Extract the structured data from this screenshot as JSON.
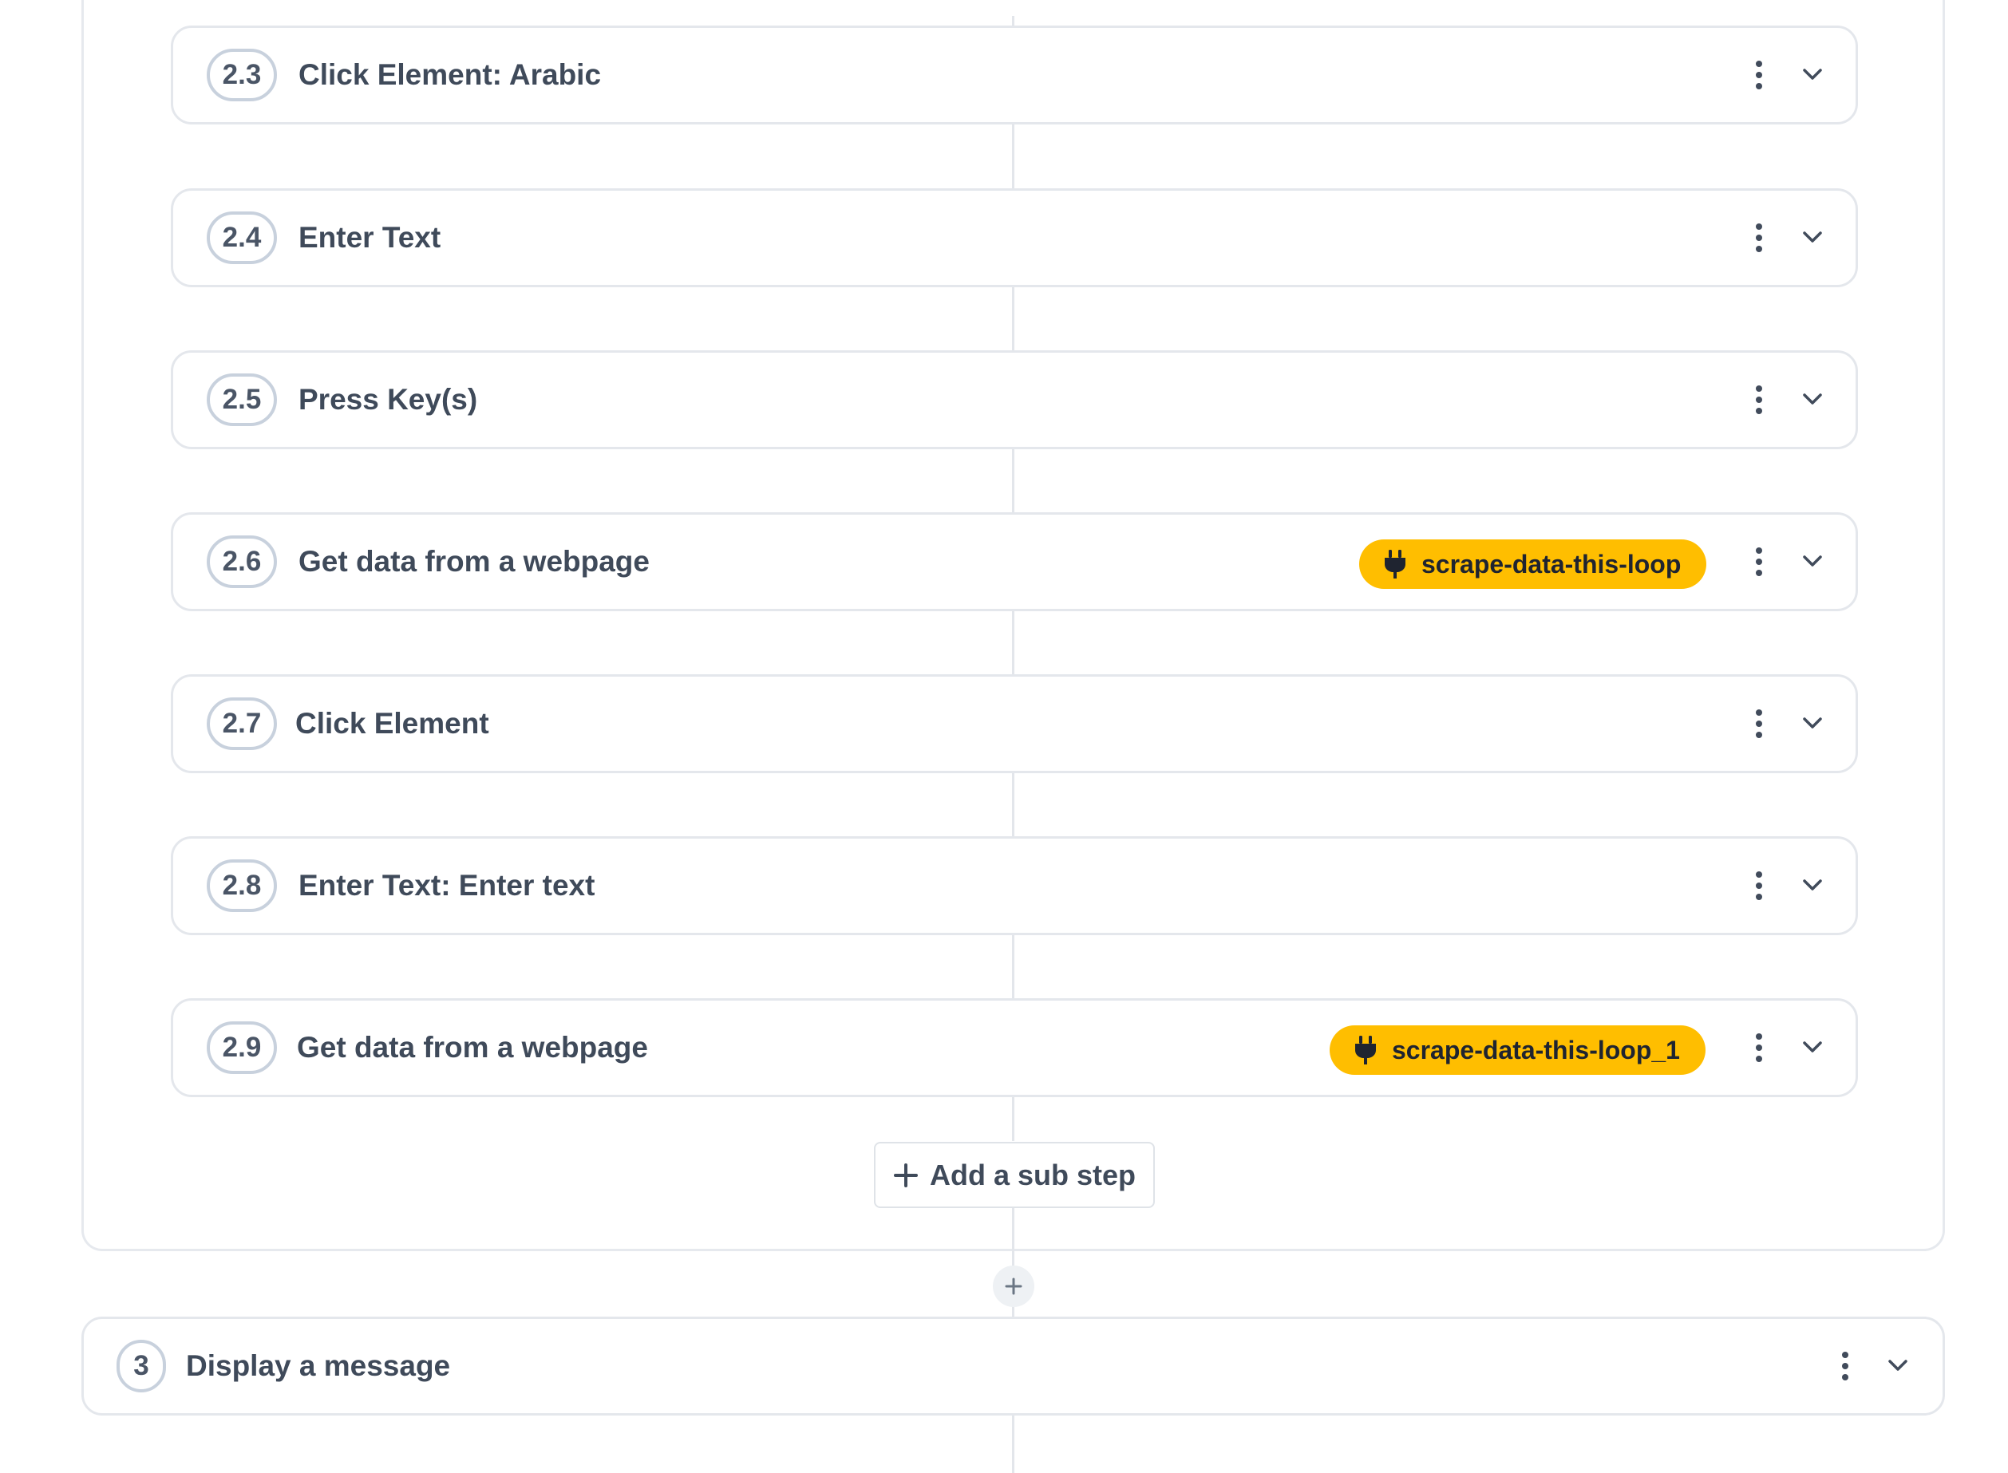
{
  "sub_steps": [
    {
      "number": "2.3",
      "title": "Click Element: Arabic",
      "tag": null
    },
    {
      "number": "2.4",
      "title": "Enter Text",
      "tag": null
    },
    {
      "number": "2.5",
      "title": "Press Key(s)",
      "tag": null
    },
    {
      "number": "2.6",
      "title": "Get data from a webpage",
      "tag": "scrape-data-this-loop"
    },
    {
      "number": "2.7",
      "title": "Click Element",
      "tag": null
    },
    {
      "number": "2.8",
      "title": "Enter Text: Enter text",
      "tag": null
    },
    {
      "number": "2.9",
      "title": "Get data from a webpage",
      "tag": "scrape-data-this-loop_1"
    }
  ],
  "add_substep_label": "Add a sub step",
  "step3": {
    "number": "3",
    "title": "Display a message"
  },
  "colors": {
    "tag_bg": "#FFBE00",
    "card_border": "#E4E7EC",
    "text": "#3F4A5A"
  },
  "icons": {
    "tag": "plug-icon",
    "menu": "kebab-icon",
    "expand": "chevron-down-icon",
    "add": "plus-icon"
  }
}
